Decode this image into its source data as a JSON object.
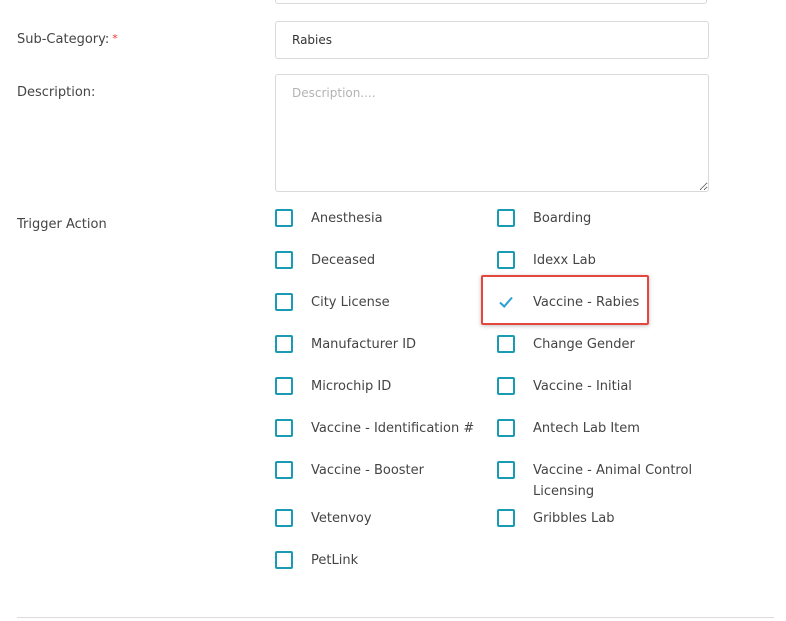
{
  "subcategory": {
    "label": "Sub-Category:",
    "required_mark": "*",
    "value": "Rabies"
  },
  "description": {
    "label": "Description:",
    "placeholder": "Description...."
  },
  "trigger_action": {
    "label": "Trigger Action",
    "options": [
      "Anesthesia",
      "Boarding",
      "Deceased",
      "Idexx Lab",
      "City License",
      "Vaccine - Rabies",
      "Manufacturer ID",
      "Change Gender",
      "Microchip ID",
      "Vaccine - Initial",
      "Vaccine - Identification #",
      "Antech Lab Item",
      "Vaccine - Booster",
      "Vaccine - Animal Control Licensing",
      "Vetenvoy",
      "Gribbles Lab",
      "PetLink"
    ],
    "checked": [
      "Vaccine - Rabies"
    ]
  },
  "colors": {
    "checkbox_border": "#1a9bb3",
    "checkmark": "#2a9fd6",
    "highlight": "#e5473e",
    "required": "#e53935"
  }
}
